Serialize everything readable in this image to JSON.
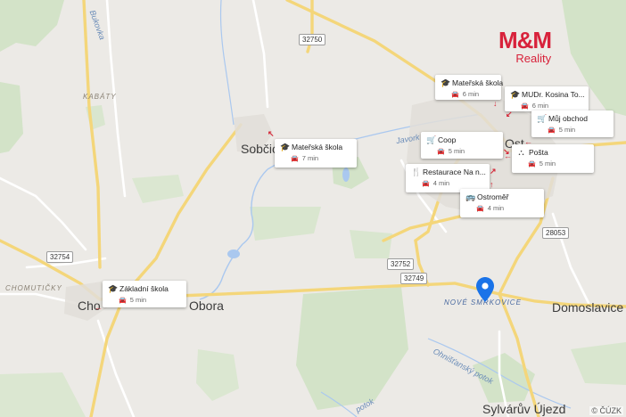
{
  "logo": {
    "brand": "M&M",
    "subtitle": "Reality"
  },
  "copyright": "© ČÚZK",
  "towns": [
    {
      "id": "sobcice",
      "label": "Sobčice"
    },
    {
      "id": "obora",
      "label": "Obora"
    },
    {
      "id": "choteborice",
      "label": "Cho"
    },
    {
      "id": "domoslavice",
      "label": "Domoslavice"
    },
    {
      "id": "sylvaruv-ujezd",
      "label": "Sylvárův Újezd"
    },
    {
      "id": "ostromer",
      "label": "Ost"
    }
  ],
  "localities": [
    {
      "id": "kabaty",
      "label": "KABÁTY"
    },
    {
      "id": "chomuticky",
      "label": "CHOMUTIČKY"
    },
    {
      "id": "nove-smrkovice",
      "label": "NOVÉ SMRKOVICE"
    }
  ],
  "rivers": [
    {
      "id": "javorka",
      "label": "Javork"
    },
    {
      "id": "bukovka",
      "label": "Bukovka"
    },
    {
      "id": "ohnistansky-potok",
      "label": "Ohnišťanský potok"
    },
    {
      "id": "potok-south",
      "label": "potok"
    }
  ],
  "roads": [
    {
      "id": "r32750",
      "label": "32750"
    },
    {
      "id": "r32754",
      "label": "32754"
    },
    {
      "id": "r32752",
      "label": "32752"
    },
    {
      "id": "r32749",
      "label": "32749"
    },
    {
      "id": "r28053",
      "label": "28053"
    }
  ],
  "pois": [
    {
      "id": "materska-skola-1",
      "icon": "graduation-cap-icon",
      "glyph": "🎓",
      "name": "Mateřská škola",
      "time": "6 min"
    },
    {
      "id": "mudr-kosina",
      "icon": "graduation-cap-icon",
      "glyph": "🎓",
      "name": "MUDr. Kosina To...",
      "time": "6 min"
    },
    {
      "id": "muj-obchod",
      "icon": "cart-icon",
      "glyph": "🛒",
      "name": "Můj obchod",
      "time": "5 min"
    },
    {
      "id": "coop",
      "icon": "cart-icon",
      "glyph": "🛒",
      "name": "Coop",
      "time": "5 min"
    },
    {
      "id": "posta",
      "icon": "post-office-icon",
      "glyph": "⛬",
      "name": "Pošta",
      "time": "5 min"
    },
    {
      "id": "restaurace",
      "icon": "fork-knife-icon",
      "glyph": "🍴",
      "name": "Restaurace Na n...",
      "time": "4 min"
    },
    {
      "id": "ostromer-bus",
      "icon": "bus-icon",
      "glyph": "🚌",
      "name": "Ostroměř",
      "time": "4 min"
    },
    {
      "id": "materska-skola-sobcice",
      "icon": "graduation-cap-icon",
      "glyph": "🎓",
      "name": "Mateřská škola",
      "time": "7 min"
    },
    {
      "id": "zakladni-skola",
      "icon": "graduation-cap-icon",
      "glyph": "🎓",
      "name": "Základní škola",
      "time": "5 min"
    }
  ],
  "colors": {
    "land": "#eceae6",
    "forest": "#d3e3c8",
    "water": "#aac8ef",
    "road_yellow": "#f4d67a",
    "road_white": "#ffffff",
    "accent_red": "#d8223b",
    "pin_blue": "#1a73e8"
  }
}
